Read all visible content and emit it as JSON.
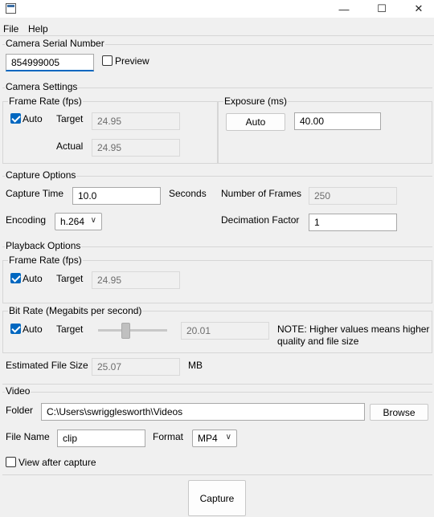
{
  "window": {
    "min_icon": "—",
    "max_icon": "☐",
    "close_icon": "✕"
  },
  "menu": [
    "File",
    "Help"
  ],
  "camera_serial": {
    "section": "Camera Serial Number",
    "value": "854999005",
    "preview_label": "Preview",
    "preview_checked": false
  },
  "camera_settings": {
    "section": "Camera Settings",
    "frame_rate": {
      "title": "Frame Rate (fps)",
      "auto_label": "Auto",
      "auto_checked": true,
      "target_label": "Target",
      "target_value": "24.95",
      "actual_label": "Actual",
      "actual_value": "24.95"
    },
    "exposure": {
      "title": "Exposure (ms)",
      "auto_button": "Auto",
      "value": "40.00"
    }
  },
  "capture_options": {
    "section": "Capture Options",
    "capture_time_label": "Capture Time",
    "capture_time_value": "10.0",
    "seconds_label": "Seconds",
    "num_frames_label": "Number of Frames",
    "num_frames_value": "250",
    "encoding_label": "Encoding",
    "encoding_value": "h.264",
    "decimation_label": "Decimation Factor",
    "decimation_value": "1"
  },
  "playback_options": {
    "section": "Playback Options",
    "frame_rate": {
      "title": "Frame Rate (fps)",
      "auto_label": "Auto",
      "auto_checked": true,
      "target_label": "Target",
      "target_value": "24.95"
    },
    "bit_rate": {
      "title": "Bit Rate (Megabits per second)",
      "auto_label": "Auto",
      "auto_checked": true,
      "target_label": "Target",
      "slider_value": "20.01",
      "note_line1": "NOTE: Higher values means higher",
      "note_line2": "quality and file size"
    },
    "file_size_label": "Estimated File Size",
    "file_size_value": "25.07",
    "file_size_unit": "MB"
  },
  "video": {
    "section": "Video",
    "folder_label": "Folder",
    "folder_value": "C:\\Users\\swrigglesworth\\Videos",
    "browse_button": "Browse",
    "file_name_label": "File Name",
    "file_name_value": "clip",
    "format_label": "Format",
    "format_value": "MP4",
    "view_after_label": "View after capture",
    "view_after_checked": false
  },
  "capture_button": "Capture"
}
